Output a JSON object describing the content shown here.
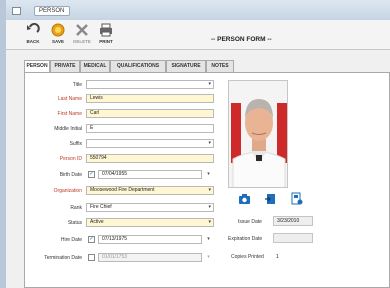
{
  "window": {
    "title": "PERSON"
  },
  "toolbar": {
    "back_label": "BACK",
    "save_label": "SAVE",
    "delete_label": "DELETE",
    "print_label": "PRINT",
    "form_title": "-- PERSON FORM --"
  },
  "tabs": [
    {
      "label": "PERSON"
    },
    {
      "label": "PRIVATE"
    },
    {
      "label": "MEDICAL"
    },
    {
      "label": "QUALIFICATIONS"
    },
    {
      "label": "SIGNATURE"
    },
    {
      "label": "NOTES"
    }
  ],
  "form": {
    "title": {
      "label": "Title",
      "value": ""
    },
    "last_name": {
      "label": "Last Name",
      "value": "Lewis"
    },
    "first_name": {
      "label": "First Name",
      "value": "Carl"
    },
    "middle_initial": {
      "label": "Middle Initial",
      "value": "E"
    },
    "suffix": {
      "label": "Suffix",
      "value": ""
    },
    "person_id": {
      "label": "Person ID",
      "value": "550794"
    },
    "birth_date": {
      "label": "Birth Date",
      "value": "07/04/1955",
      "checked": true
    },
    "organization": {
      "label": "Organization",
      "value": "Moosewood Fire Department"
    },
    "rank": {
      "label": "Rank",
      "value": "Fire Chief"
    },
    "status": {
      "label": "Status",
      "value": "Active"
    },
    "hire_date": {
      "label": "Hire Date",
      "value": "07/13/1975",
      "checked": true
    },
    "termination_date": {
      "label": "Termination Date",
      "value": "01/01/1753",
      "checked": false
    }
  },
  "badge": {
    "issue_date_label": "Issue Date",
    "issue_date": "3/23/2010",
    "expiration_date_label": "Expiration Date",
    "expiration_date": "",
    "copies_printed_label": "Copies Printed",
    "copies_printed": "1"
  },
  "colors": {
    "required_label": "#c0392b",
    "required_field": "#fff7d1",
    "accent_blue": "#1f6fb8"
  }
}
